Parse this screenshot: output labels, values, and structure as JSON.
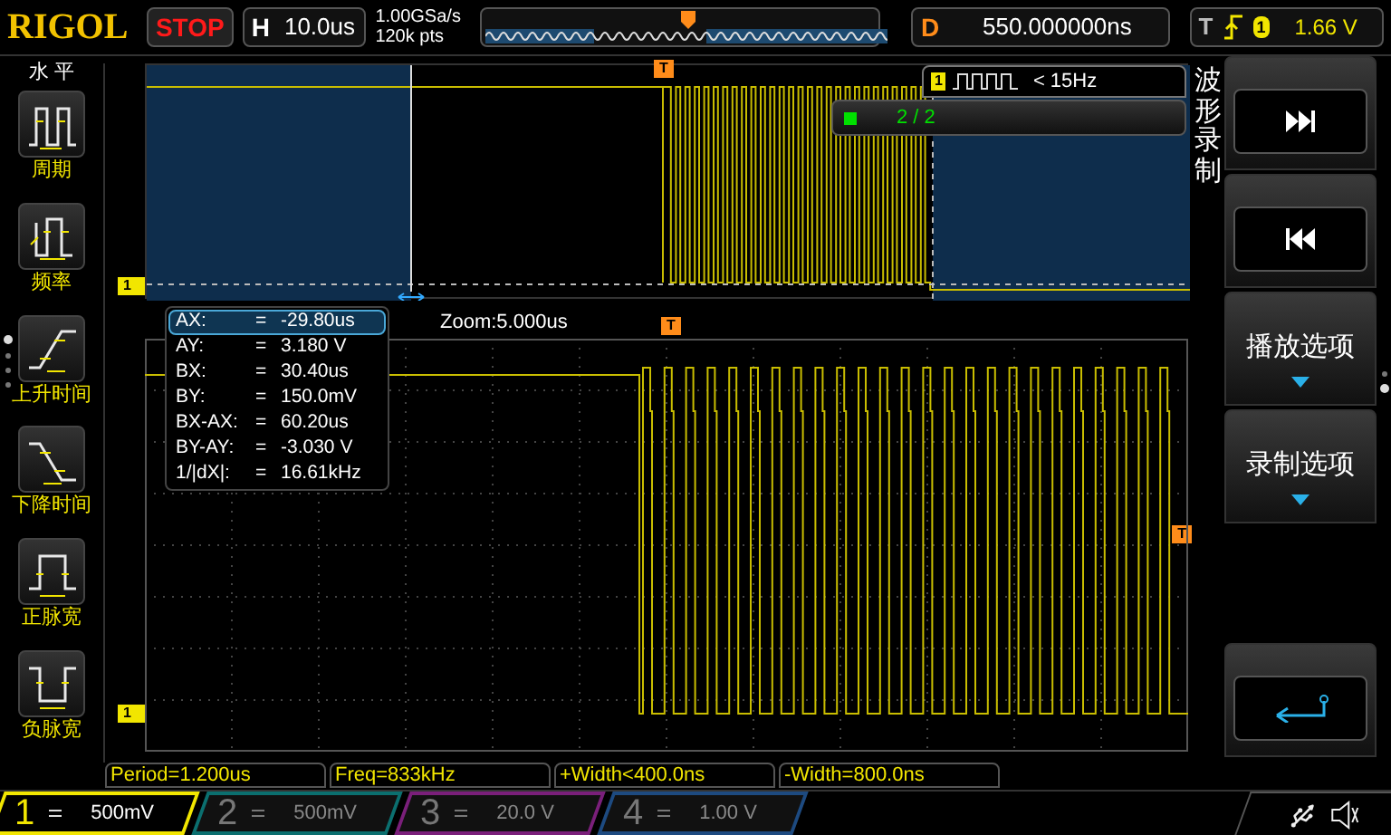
{
  "top_bar": {
    "logo": "RIGOL",
    "run_state": "STOP",
    "timebase": {
      "label": "H",
      "value": "10.0us"
    },
    "sample_rate": "1.00GSa/s",
    "memory_depth": "120k pts",
    "delay": {
      "label": "D",
      "value": "550.000000ns"
    },
    "trigger": {
      "label": "T",
      "source": "1",
      "level": "1.66 V"
    }
  },
  "left_menu": {
    "title": "水 平",
    "items": [
      {
        "kind": "period",
        "label": "周期"
      },
      {
        "kind": "frequency",
        "label": "频率"
      },
      {
        "kind": "rise",
        "label": "上升时间"
      },
      {
        "kind": "fall",
        "label": "下降时间"
      },
      {
        "kind": "pos_width",
        "label": "正脉宽"
      },
      {
        "kind": "neg_width",
        "label": "负脉宽"
      }
    ],
    "pages": [
      {
        "selected": true
      },
      {
        "selected": false
      },
      {
        "selected": false
      },
      {
        "selected": false
      }
    ]
  },
  "overview": {
    "channel_marker": "1",
    "trigger_marker": "T",
    "trigger_filter": {
      "source": "1",
      "text": "< 15Hz"
    },
    "frame_counter": "2 / 2"
  },
  "zoom_label": "Zoom:5.000us",
  "main": {
    "channel_marker": "1",
    "trigger_marker": "T",
    "level_marker": "T"
  },
  "cursor_readout": [
    {
      "label": "AX:",
      "sign": "=",
      "value": "-29.80us",
      "selected": true
    },
    {
      "label": "AY:",
      "sign": "=",
      "value": "3.180 V",
      "selected": false
    },
    {
      "label": "BX:",
      "sign": "=",
      "value": "30.40us",
      "selected": false
    },
    {
      "label": "BY:",
      "sign": "=",
      "value": "150.0mV",
      "selected": false
    },
    {
      "label": "BX-AX:",
      "sign": "=",
      "value": "60.20us",
      "selected": false
    },
    {
      "label": "BY-AY:",
      "sign": "=",
      "value": "-3.030 V",
      "selected": false
    },
    {
      "label": "1/|dX|:",
      "sign": "=",
      "value": "16.61kHz",
      "selected": false
    }
  ],
  "right_menu": {
    "title": "波形录制",
    "buttons": [
      {
        "kind": "next"
      },
      {
        "kind": "previous"
      },
      {
        "kind": "dropdown",
        "label": "播放选项"
      },
      {
        "kind": "dropdown",
        "label": "录制选项"
      },
      {
        "kind": "back"
      }
    ],
    "pages": [
      {
        "selected": false
      },
      {
        "selected": true
      }
    ]
  },
  "measurements": [
    "Period=1.200us",
    "Freq=833kHz",
    "+Width<400.0ns",
    "-Width=800.0ns"
  ],
  "channels": [
    {
      "number": "1",
      "scale": "500mV",
      "active": true,
      "color": "#f2e600"
    },
    {
      "number": "2",
      "scale": "500mV",
      "active": false,
      "color": "#0b6f6f"
    },
    {
      "number": "3",
      "scale": "20.0 V",
      "active": false,
      "color": "#7a1f7a"
    },
    {
      "number": "4",
      "scale": "1.00 V",
      "active": false,
      "color": "#1d4a80"
    }
  ]
}
